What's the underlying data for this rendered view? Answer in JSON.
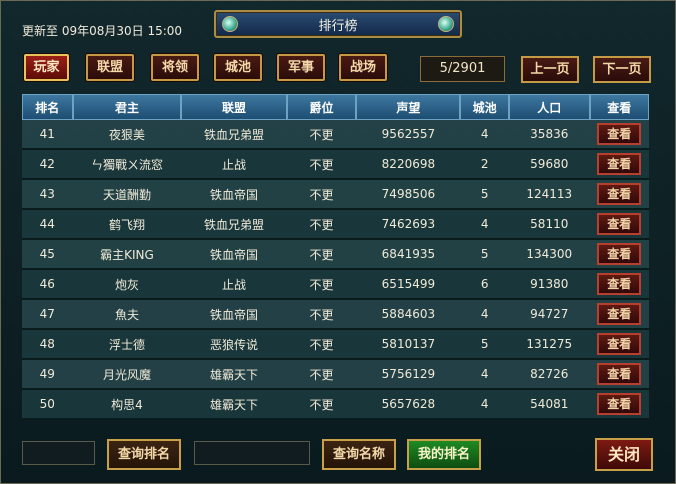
{
  "window": {
    "title": "排行榜"
  },
  "update_text": "更新至 09年08月30日 15:00",
  "tabs": [
    {
      "label": "玩家",
      "active": true
    },
    {
      "label": "联盟",
      "active": false
    },
    {
      "label": "将领",
      "active": false
    },
    {
      "label": "城池",
      "active": false
    },
    {
      "label": "军事",
      "active": false
    },
    {
      "label": "战场",
      "active": false
    }
  ],
  "pagination": {
    "page_text": "5/2901",
    "prev_label": "上一页",
    "next_label": "下一页"
  },
  "table": {
    "headers": [
      "排名",
      "君主",
      "联盟",
      "爵位",
      "声望",
      "城池",
      "人口",
      "查看"
    ],
    "rows": [
      [
        "41",
        "夜狠美",
        "铁血兄弟盟",
        "不更",
        "9562557",
        "4",
        "35836",
        "查看"
      ],
      [
        "42",
        "ㄣ獨戰ㄨ流窓",
        "止战",
        "不更",
        "8220698",
        "2",
        "59680",
        "查看"
      ],
      [
        "43",
        "天道酬勤",
        "铁血帝国",
        "不更",
        "7498506",
        "5",
        "124113",
        "查看"
      ],
      [
        "44",
        "鹤飞翔",
        "铁血兄弟盟",
        "不更",
        "7462693",
        "4",
        "58110",
        "查看"
      ],
      [
        "45",
        "霸主KING",
        "铁血帝国",
        "不更",
        "6841935",
        "5",
        "134300",
        "查看"
      ],
      [
        "46",
        "炮灰",
        "止战",
        "不更",
        "6515499",
        "6",
        "91380",
        "查看"
      ],
      [
        "47",
        "魚夫",
        "铁血帝国",
        "不更",
        "5884603",
        "4",
        "94727",
        "查看"
      ],
      [
        "48",
        "浮士德",
        "恶狼传说",
        "不更",
        "5810137",
        "5",
        "131275",
        "查看"
      ],
      [
        "49",
        "月光风魔",
        "雄霸天下",
        "不更",
        "5756129",
        "4",
        "82726",
        "查看"
      ],
      [
        "50",
        "构思4",
        "雄霸天下",
        "不更",
        "5657628",
        "4",
        "54081",
        "查看"
      ]
    ]
  },
  "bottom": {
    "rank_query_input_value": "",
    "query_rank_label": "查询排名",
    "name_query_input_value": "",
    "query_name_label": "查询名称",
    "my_rank_label": "我的排名",
    "close_label": "关闭"
  },
  "colors": {
    "accent_gold": "#c49a44",
    "header_blue": "#2f6a92",
    "button_red": "#8a1a14",
    "button_green": "#1e8a22"
  }
}
